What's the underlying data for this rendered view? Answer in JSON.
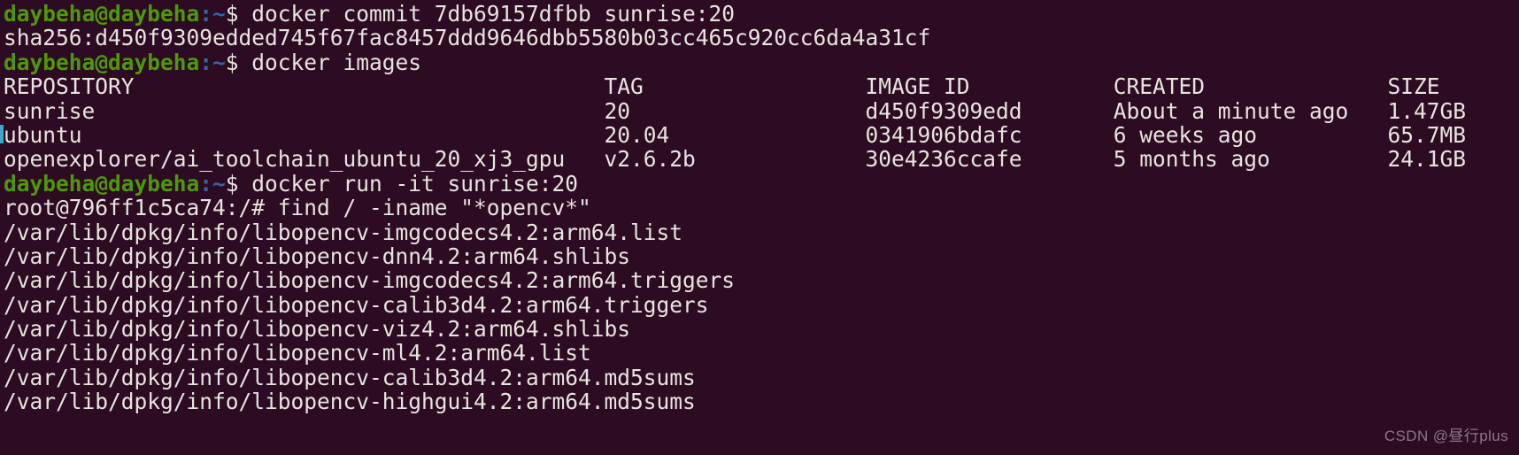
{
  "terminal": {
    "background_color": "#2d0b22",
    "foreground_color": "#e8e4e0",
    "user_color": "#4e9a06",
    "path_color": "#3465a4",
    "prompt_user": "daybeha@daybeha",
    "prompt_path": ":~",
    "prompt_symbol": "$ ",
    "root_prompt": "root@796ff1c5ca74:/# "
  },
  "lines": {
    "cmd_commit": "docker commit 7db69157dfbb sunrise:20",
    "out_sha": "sha256:d450f9309edded745f67fac8457ddd9646dbb5580b03cc465c920cc6da4a31cf",
    "cmd_images": "docker images",
    "cmd_run": "docker run -it sunrise:20",
    "cmd_find": "find / -iname \"*opencv*\""
  },
  "images_table": {
    "headers": [
      "REPOSITORY",
      "TAG",
      "IMAGE ID",
      "CREATED",
      "SIZE"
    ],
    "rows": [
      {
        "repository": "sunrise",
        "tag": "20",
        "image_id": "d450f9309edd",
        "created": "About a minute ago",
        "size": "1.47GB"
      },
      {
        "repository": "ubuntu",
        "tag": "20.04",
        "image_id": "0341906bdafc",
        "created": "6 weeks ago",
        "size": "65.7MB"
      },
      {
        "repository": "openexplorer/ai_toolchain_ubuntu_20_xj3_gpu",
        "tag": "v2.6.2b",
        "image_id": "30e4236ccafe",
        "created": "5 months ago",
        "size": "24.1GB"
      }
    ]
  },
  "find_results": [
    "/var/lib/dpkg/info/libopencv-imgcodecs4.2:arm64.list",
    "/var/lib/dpkg/info/libopencv-dnn4.2:arm64.shlibs",
    "/var/lib/dpkg/info/libopencv-imgcodecs4.2:arm64.triggers",
    "/var/lib/dpkg/info/libopencv-calib3d4.2:arm64.triggers",
    "/var/lib/dpkg/info/libopencv-viz4.2:arm64.shlibs",
    "/var/lib/dpkg/info/libopencv-ml4.2:arm64.list",
    "/var/lib/dpkg/info/libopencv-calib3d4.2:arm64.md5sums",
    "/var/lib/dpkg/info/libopencv-highgui4.2:arm64.md5sums"
  ],
  "watermark": "CSDN @昼行plus"
}
